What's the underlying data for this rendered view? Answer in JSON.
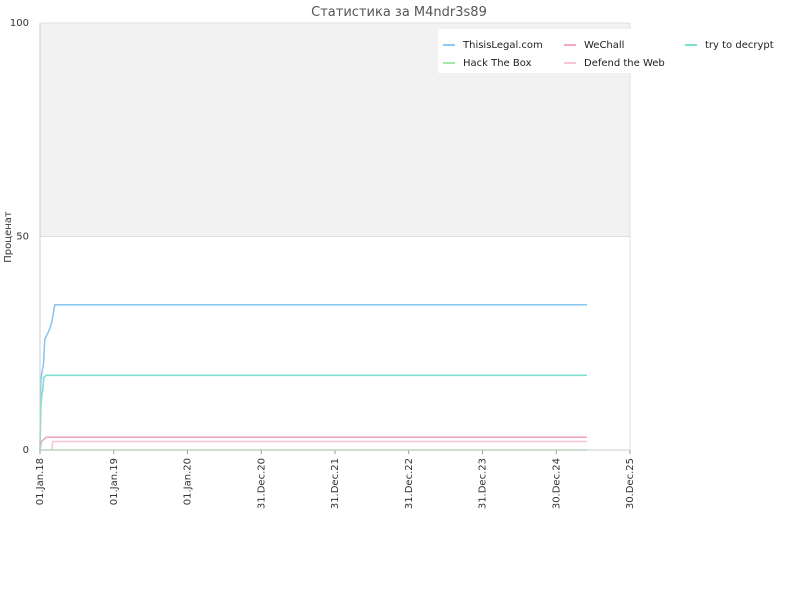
{
  "chart_data": {
    "type": "line",
    "title": "Статистика за M4ndr3s89",
    "xlabel": "",
    "ylabel": "Проценат",
    "ylim": [
      0,
      100
    ],
    "y_ticks": [
      "0",
      "50",
      "100"
    ],
    "y_tick_values": [
      0,
      50,
      100
    ],
    "x_ticks": [
      "01.Jan.18",
      "01.Jan.19",
      "01.Jan.20",
      "31.Dec.20",
      "31.Dec.21",
      "31.Dec.22",
      "31.Dec.23",
      "30.Dec.24",
      "30.Dec.25"
    ],
    "xlim": [
      "2018-01-01",
      "2025-12-30"
    ],
    "grid": true,
    "background_band": {
      "from": 50,
      "to": 100,
      "color": "#f2f2f2"
    },
    "legend": {
      "placement": "top-right",
      "columns": 3
    },
    "series": [
      {
        "name": "ThisisLegal.com",
        "color": "#8ec8f0",
        "points": [
          [
            "2018-01-01",
            0
          ],
          [
            "2018-01-05",
            16
          ],
          [
            "2018-01-10",
            18
          ],
          [
            "2018-01-18",
            20
          ],
          [
            "2018-01-25",
            26
          ],
          [
            "2018-02-05",
            27
          ],
          [
            "2018-02-15",
            28
          ],
          [
            "2018-03-01",
            30
          ],
          [
            "2018-03-15",
            34
          ],
          [
            "2025-05-31",
            34
          ]
        ]
      },
      {
        "name": "WeChall",
        "color": "#f4a6c6",
        "points": [
          [
            "2018-01-01",
            0
          ],
          [
            "2018-01-08",
            2
          ],
          [
            "2018-02-01",
            3
          ],
          [
            "2025-05-31",
            3
          ]
        ]
      },
      {
        "name": "try to decrypt",
        "color": "#7de0cc",
        "points": [
          [
            "2018-01-01",
            0
          ],
          [
            "2018-01-05",
            10
          ],
          [
            "2018-01-10",
            13
          ],
          [
            "2018-01-15",
            14
          ],
          [
            "2018-01-20",
            17
          ],
          [
            "2018-02-01",
            17.5
          ],
          [
            "2025-05-31",
            17.5
          ]
        ]
      },
      {
        "name": "Hack The Box",
        "color": "#a6e6a6",
        "points": [
          [
            "2018-01-01",
            0
          ],
          [
            "2025-05-31",
            0
          ]
        ]
      },
      {
        "name": "Defend the Web",
        "color": "#f7c6d6",
        "points": [
          [
            "2018-03-01",
            0
          ],
          [
            "2018-03-05",
            2
          ],
          [
            "2025-05-31",
            2
          ]
        ]
      }
    ]
  }
}
